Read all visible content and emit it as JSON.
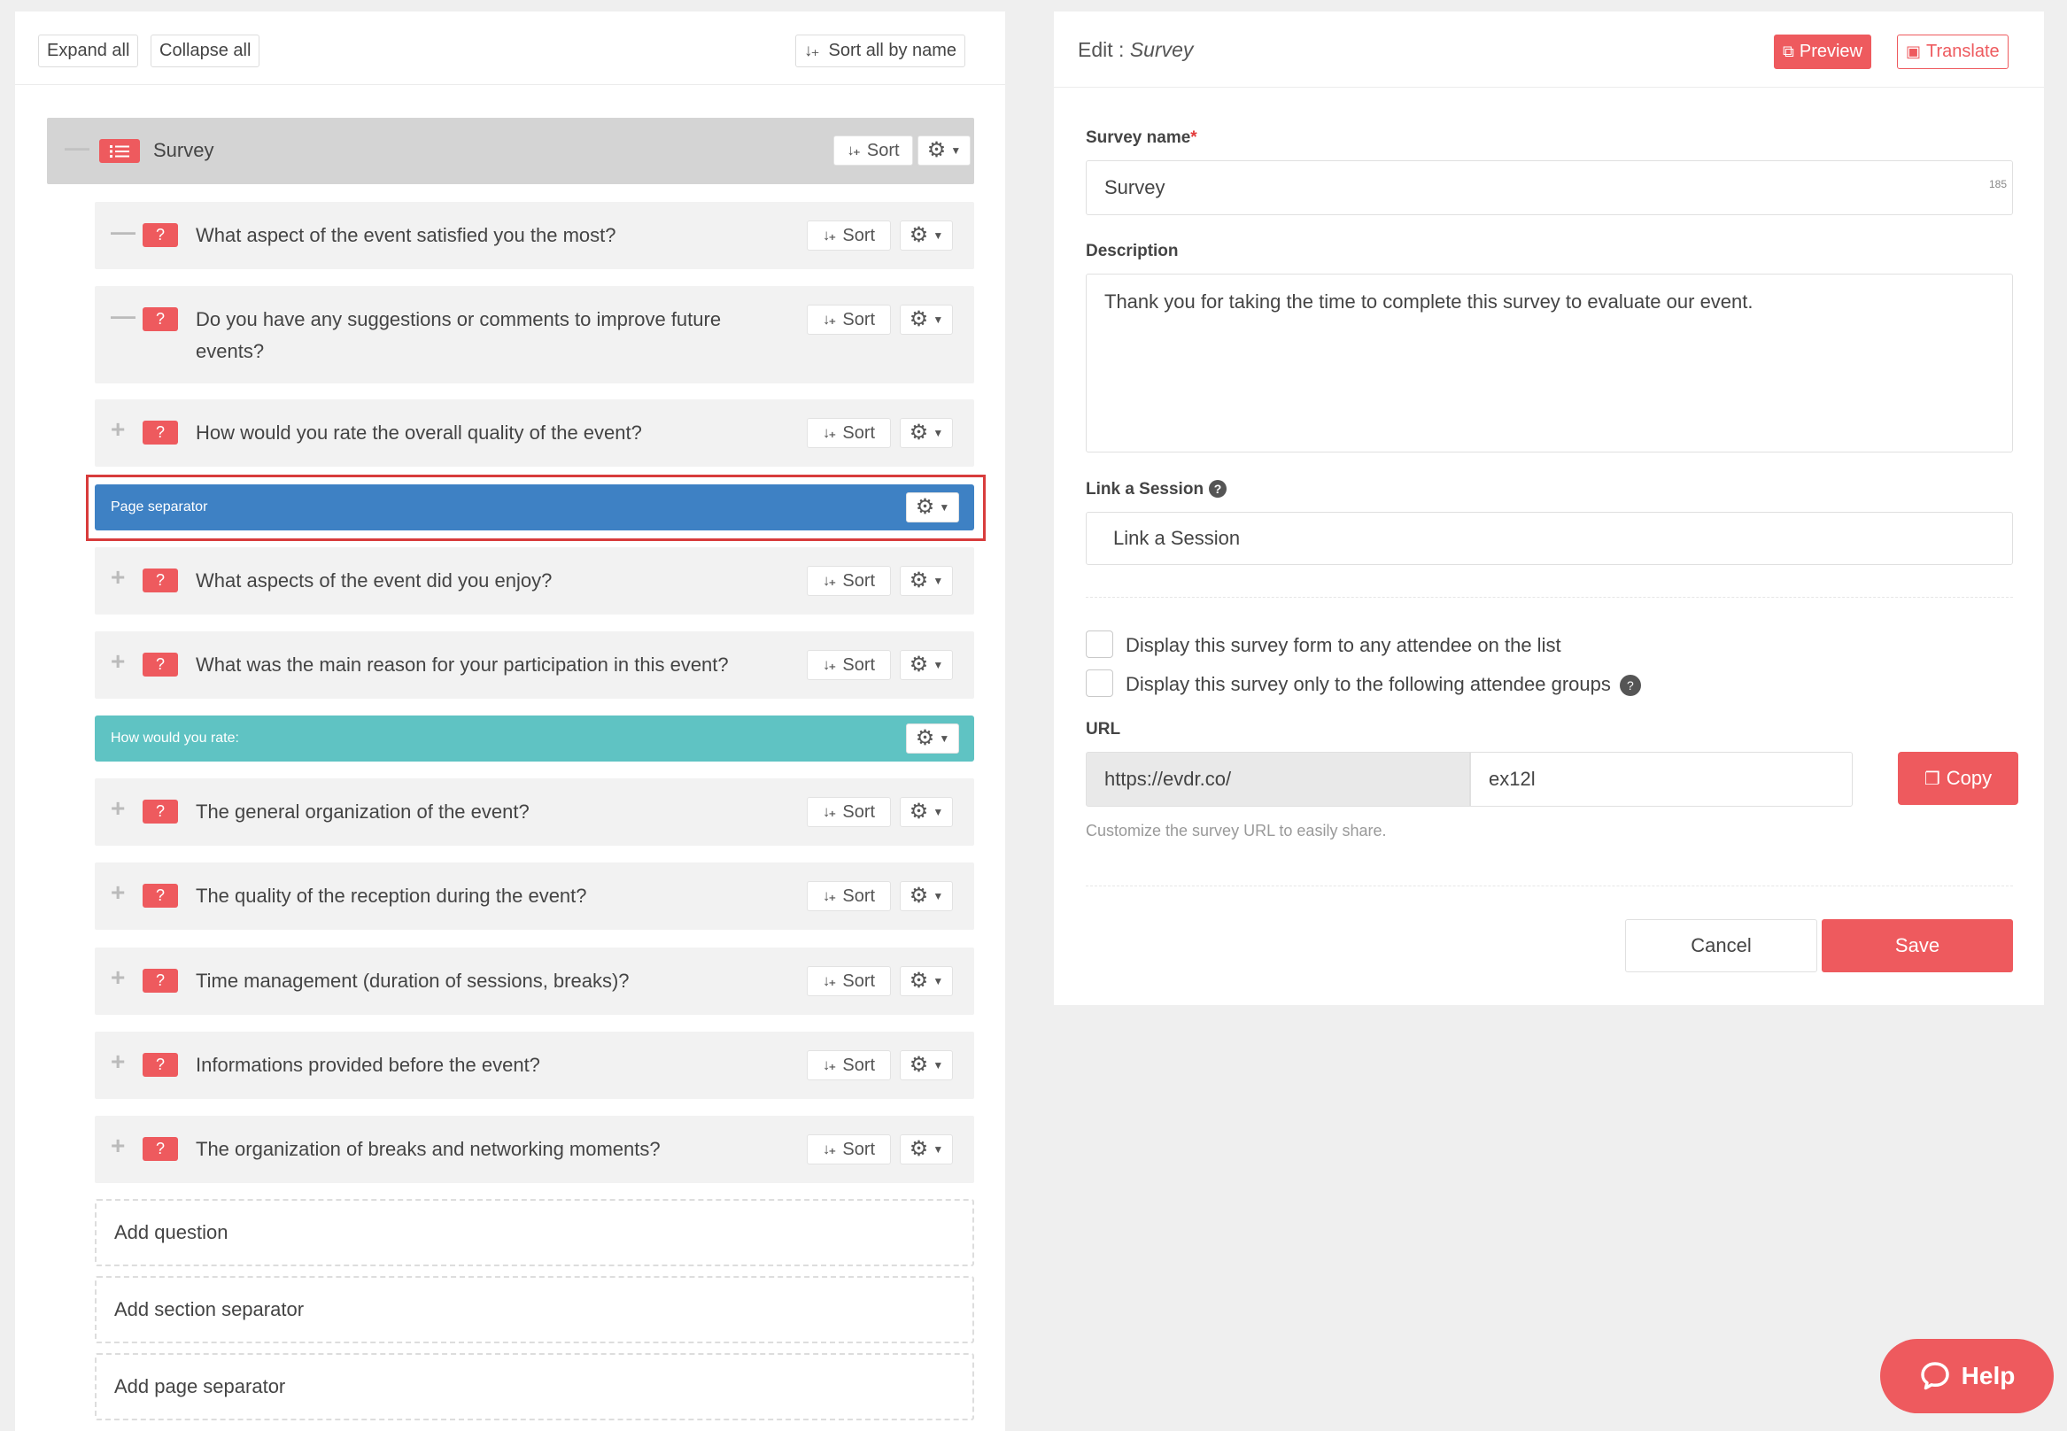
{
  "toolbar": {
    "expand_all": "Expand all",
    "collapse_all": "Collapse all",
    "sort_all_by_name": "Sort all by name"
  },
  "tree": {
    "root": {
      "label": "Survey",
      "sort_label": "Sort",
      "toggle": "—"
    },
    "items": [
      {
        "kind": "question",
        "toggle": "—",
        "text": "What aspect of the event satisfied you the most?",
        "sort_label": "Sort"
      },
      {
        "kind": "question",
        "toggle": "—",
        "text": "Do you have any suggestions or comments to improve future events?",
        "sort_label": "Sort"
      },
      {
        "kind": "question",
        "toggle": "+",
        "text": "How would you rate the overall quality of the event?",
        "sort_label": "Sort"
      },
      {
        "kind": "page-separator",
        "text": "Page separator"
      },
      {
        "kind": "question",
        "toggle": "+",
        "text": "What aspects of the event did you enjoy?",
        "sort_label": "Sort"
      },
      {
        "kind": "question",
        "toggle": "+",
        "text": "What was the main reason for your participation in this event?",
        "sort_label": "Sort"
      },
      {
        "kind": "section-separator",
        "text": "How would you rate:"
      },
      {
        "kind": "question",
        "toggle": "+",
        "text": "The general organization of the event?",
        "sort_label": "Sort"
      },
      {
        "kind": "question",
        "toggle": "+",
        "text": "The quality of the reception during the event?",
        "sort_label": "Sort"
      },
      {
        "kind": "question",
        "toggle": "+",
        "text": "Time management (duration of sessions, breaks)?",
        "sort_label": "Sort"
      },
      {
        "kind": "question",
        "toggle": "+",
        "text": "Informations provided before the event?",
        "sort_label": "Sort"
      },
      {
        "kind": "question",
        "toggle": "+",
        "text": "The organization of breaks and networking moments?",
        "sort_label": "Sort"
      }
    ],
    "add_question": "Add question",
    "add_section_separator": "Add section separator",
    "add_page_separator": "Add page separator"
  },
  "editor": {
    "title_prefix": "Edit :",
    "title_name": "Survey",
    "preview_label": "Preview",
    "translate_label": "Translate",
    "survey_name_label": "Survey name",
    "required_mark": "*",
    "survey_name_value": "Survey",
    "survey_name_counter": "185",
    "description_label": "Description",
    "description_value": "Thank you for taking the time to complete this survey to evaluate our event.",
    "link_session_label": "Link a Session",
    "link_session_placeholder": "Link a Session",
    "checkbox_any_attendee": "Display this survey form to any attendee on the list",
    "checkbox_groups": "Display this survey only to the following attendee groups",
    "url_label": "URL",
    "url_prefix": "https://evdr.co/",
    "url_slug": "ex12l",
    "copy_label": "Copy",
    "url_hint": "Customize the survey URL to easily share.",
    "cancel_label": "Cancel",
    "save_label": "Save"
  },
  "help": {
    "label": "Help"
  },
  "colors": {
    "accent": "#ee5a5e",
    "page_separator": "#3e81c4",
    "section_separator": "#5fc3c3",
    "root_row": "#d4d4d4",
    "row": "#f2f2f2"
  },
  "icons": {
    "sort": "sort-alpha-icon",
    "gear": "gear-icon",
    "question": "question-mark-icon",
    "list": "list-icon",
    "preview": "external-link-icon",
    "translate": "translate-icon",
    "copy": "copy-icon",
    "help": "chat-bubble-icon"
  }
}
